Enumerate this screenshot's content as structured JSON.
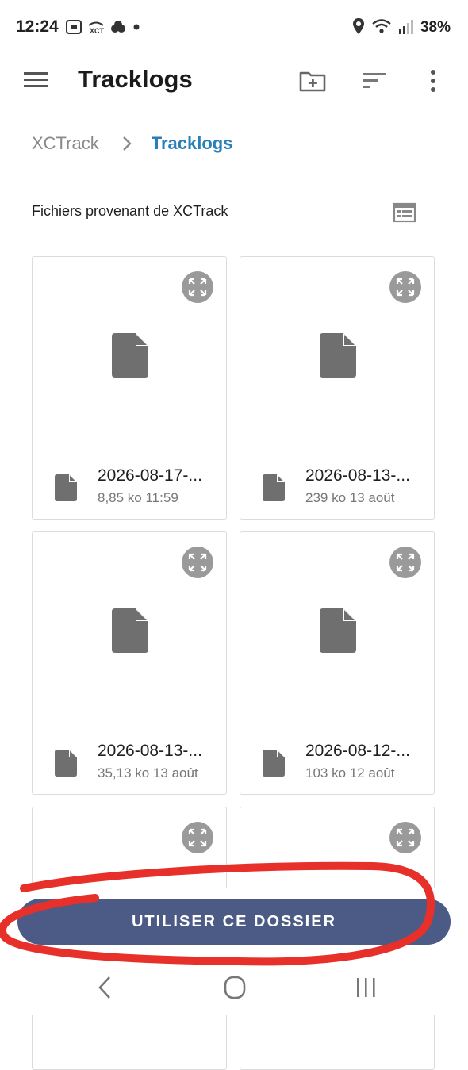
{
  "status_bar": {
    "time": "12:24",
    "battery": "38%",
    "icons_left": [
      "screenshot-icon",
      "xct-app-icon",
      "cloud-icon",
      "dot-icon"
    ],
    "icons_right": [
      "location-icon",
      "wifi-icon",
      "signal-icon"
    ]
  },
  "app_bar": {
    "title": "Tracklogs",
    "actions": [
      "new-folder-icon",
      "sort-icon",
      "more-vert-icon"
    ]
  },
  "breadcrumb": {
    "root": "XCTrack",
    "current": "Tracklogs"
  },
  "section": {
    "title": "Fichiers provenant de XCTrack"
  },
  "files": [
    {
      "name": "2026-08-17-...",
      "meta": "8,85 ko 11:59"
    },
    {
      "name": "2026-08-13-...",
      "meta": "239 ko 13 août"
    },
    {
      "name": "2026-08-13-...",
      "meta": "35,13 ko 13 août"
    },
    {
      "name": "2026-08-12-...",
      "meta": "103 ko 12 août"
    }
  ],
  "bottom_button": {
    "label": "UTILISER CE DOSSIER"
  },
  "colors": {
    "accent": "#2a7fb9",
    "button": "#4c5a86",
    "icon_gray": "#6f6f6f",
    "annotation_red": "#e8302a"
  }
}
